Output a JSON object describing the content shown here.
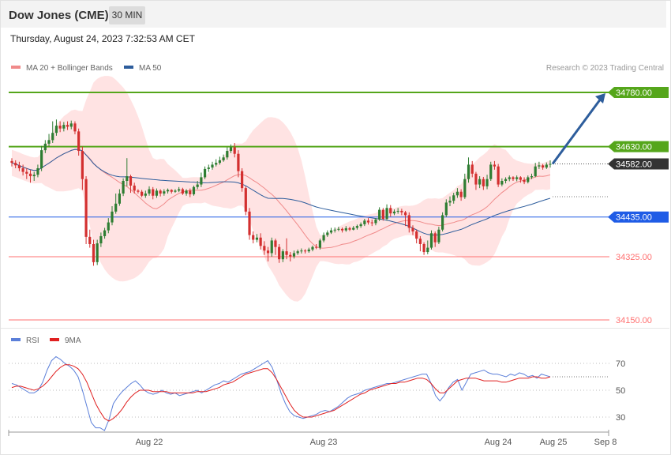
{
  "header": {
    "title": "Dow Jones (CME)",
    "interval": "30 MIN",
    "timestamp": "Thursday, August 24, 2023 7:32:53 AM CET",
    "copyright": "Research © 2023 Trading Central"
  },
  "legend_main": [
    {
      "label": "MA 20 + Bollinger Bands",
      "color": "#f08a8a"
    },
    {
      "label": "MA 50",
      "color": "#2d5d9c"
    }
  ],
  "legend_rsi": [
    {
      "label": "RSI",
      "color": "#5b7fd9"
    },
    {
      "label": "9MA",
      "color": "#e02020"
    }
  ],
  "chart_data": [
    {
      "type": "candlestick",
      "price_range": [
        34150,
        34830
      ],
      "levels": [
        {
          "value": 34780,
          "label": "34780.00",
          "color": "#55a61b",
          "style": "resistance"
        },
        {
          "value": 34630,
          "label": "34630.00",
          "color": "#55a61b",
          "style": "resistance"
        },
        {
          "value": 34582,
          "label": "34582.00",
          "color": "#333333",
          "style": "last"
        },
        {
          "value": 34435,
          "label": "34435.00",
          "color": "#1f5ce6",
          "style": "pivot"
        },
        {
          "value": 34325,
          "label": "34325.00",
          "color": "#ff7070",
          "style": "support"
        },
        {
          "value": 34150,
          "label": "34150.00",
          "color": "#ff7070",
          "style": "support"
        }
      ],
      "candles": [
        [
          34590,
          34585,
          34598,
          34575
        ],
        [
          34585,
          34578,
          34592,
          34570
        ],
        [
          34578,
          34570,
          34588,
          34562
        ],
        [
          34570,
          34560,
          34580,
          34550
        ],
        [
          34560,
          34555,
          34570,
          34540
        ],
        [
          34555,
          34548,
          34565,
          34530
        ],
        [
          34548,
          34552,
          34560,
          34535
        ],
        [
          34552,
          34570,
          34580,
          34545
        ],
        [
          34570,
          34620,
          34632,
          34562
        ],
        [
          34620,
          34638,
          34648,
          34612
        ],
        [
          34638,
          34648,
          34665,
          34630
        ],
        [
          34648,
          34668,
          34700,
          34640
        ],
        [
          34668,
          34688,
          34705,
          34660
        ],
        [
          34688,
          34680,
          34700,
          34670
        ],
        [
          34680,
          34690,
          34698,
          34672
        ],
        [
          34690,
          34685,
          34700,
          34676
        ],
        [
          34685,
          34694,
          34702,
          34678
        ],
        [
          34694,
          34672,
          34700,
          34664
        ],
        [
          34672,
          34618,
          34680,
          34605
        ],
        [
          34618,
          34540,
          34630,
          34510
        ],
        [
          34540,
          34380,
          34548,
          34360
        ],
        [
          34380,
          34360,
          34400,
          34350
        ],
        [
          34360,
          34310,
          34372,
          34300
        ],
        [
          34310,
          34362,
          34372,
          34302
        ],
        [
          34362,
          34382,
          34392,
          34352
        ],
        [
          34382,
          34398,
          34405,
          34375
        ],
        [
          34398,
          34420,
          34432,
          34390
        ],
        [
          34420,
          34450,
          34465,
          34412
        ],
        [
          34450,
          34472,
          34500,
          34444
        ],
        [
          34472,
          34500,
          34512,
          34466
        ],
        [
          34500,
          34535,
          34542,
          34493
        ],
        [
          34535,
          34548,
          34598,
          34520
        ],
        [
          34548,
          34522,
          34552,
          34502
        ],
        [
          34522,
          34508,
          34530,
          34500
        ],
        [
          34508,
          34505,
          34512,
          34500
        ],
        [
          34505,
          34494,
          34510,
          34490
        ],
        [
          34494,
          34500,
          34508,
          34488
        ],
        [
          34500,
          34512,
          34520,
          34494
        ],
        [
          34512,
          34494,
          34518,
          34484
        ],
        [
          34494,
          34508,
          34514,
          34488
        ],
        [
          34508,
          34500,
          34512,
          34492
        ],
        [
          34500,
          34506,
          34512,
          34494
        ],
        [
          34506,
          34510,
          34514,
          34500
        ],
        [
          34510,
          34505,
          34512,
          34500
        ],
        [
          34505,
          34508,
          34512,
          34502
        ],
        [
          34508,
          34512,
          34518,
          34504
        ],
        [
          34512,
          34500,
          34516,
          34496
        ],
        [
          34500,
          34508,
          34512,
          34494
        ],
        [
          34508,
          34498,
          34514,
          34490
        ],
        [
          34498,
          34518,
          34522,
          34494
        ],
        [
          34518,
          34525,
          34535,
          34512
        ],
        [
          34525,
          34545,
          34558,
          34518
        ],
        [
          34545,
          34568,
          34575,
          34540
        ],
        [
          34568,
          34572,
          34580,
          34560
        ],
        [
          34572,
          34580,
          34588,
          34566
        ],
        [
          34580,
          34585,
          34595,
          34575
        ],
        [
          34585,
          34592,
          34602,
          34580
        ],
        [
          34592,
          34600,
          34608,
          34588
        ],
        [
          34600,
          34618,
          34628,
          34594
        ],
        [
          34618,
          34628,
          34636,
          34612
        ],
        [
          34628,
          34610,
          34640,
          34600
        ],
        [
          34610,
          34562,
          34620,
          34545
        ],
        [
          34562,
          34515,
          34570,
          34505
        ],
        [
          34515,
          34450,
          34520,
          34440
        ],
        [
          34450,
          34385,
          34460,
          34372
        ],
        [
          34385,
          34372,
          34395,
          34362
        ],
        [
          34372,
          34378,
          34388,
          34365
        ],
        [
          34378,
          34355,
          34390,
          34345
        ],
        [
          34355,
          34342,
          34368,
          34330
        ],
        [
          34342,
          34335,
          34352,
          34312
        ],
        [
          34335,
          34370,
          34378,
          34325
        ],
        [
          34370,
          34352,
          34375,
          34330
        ],
        [
          34352,
          34318,
          34360,
          34308
        ],
        [
          34318,
          34340,
          34346,
          34310
        ],
        [
          34340,
          34330,
          34376,
          34318
        ],
        [
          34330,
          34326,
          34338,
          34312
        ],
        [
          34326,
          34335,
          34342,
          34320
        ],
        [
          34335,
          34340,
          34345,
          34330
        ],
        [
          34340,
          34342,
          34348,
          34334
        ],
        [
          34342,
          34340,
          34346,
          34334
        ],
        [
          34340,
          34345,
          34350,
          34336
        ],
        [
          34345,
          34352,
          34356,
          34340
        ],
        [
          34352,
          34350,
          34360,
          34346
        ],
        [
          34350,
          34370,
          34375,
          34345
        ],
        [
          34370,
          34385,
          34392,
          34365
        ],
        [
          34385,
          34392,
          34398,
          34380
        ],
        [
          34392,
          34398,
          34405,
          34388
        ],
        [
          34398,
          34400,
          34406,
          34392
        ],
        [
          34400,
          34402,
          34408,
          34396
        ],
        [
          34402,
          34398,
          34406,
          34392
        ],
        [
          34398,
          34404,
          34410,
          34394
        ],
        [
          34404,
          34400,
          34408,
          34396
        ],
        [
          34400,
          34405,
          34410,
          34398
        ],
        [
          34405,
          34410,
          34414,
          34400
        ],
        [
          34410,
          34415,
          34420,
          34405
        ],
        [
          34415,
          34425,
          34430,
          34410
        ],
        [
          34425,
          34420,
          34432,
          34414
        ],
        [
          34420,
          34418,
          34428,
          34410
        ],
        [
          34418,
          34428,
          34432,
          34412
        ],
        [
          34428,
          34455,
          34462,
          34424
        ],
        [
          34455,
          34430,
          34460,
          34425
        ],
        [
          34430,
          34460,
          34470,
          34425
        ],
        [
          34460,
          34445,
          34468,
          34436
        ],
        [
          34445,
          34450,
          34456,
          34440
        ],
        [
          34450,
          34452,
          34460,
          34444
        ],
        [
          34452,
          34448,
          34458,
          34440
        ],
        [
          34448,
          34440,
          34452,
          34410
        ],
        [
          34440,
          34405,
          34448,
          34392
        ],
        [
          34405,
          34395,
          34412,
          34385
        ],
        [
          34395,
          34375,
          34400,
          34362
        ],
        [
          34375,
          34360,
          34382,
          34340
        ],
        [
          34360,
          34338,
          34365,
          34330
        ],
        [
          34338,
          34350,
          34370,
          34332
        ],
        [
          34350,
          34390,
          34398,
          34345
        ],
        [
          34390,
          34365,
          34395,
          34352
        ],
        [
          34365,
          34400,
          34408,
          34360
        ],
        [
          34400,
          34440,
          34448,
          34395
        ],
        [
          34440,
          34475,
          34484,
          34435
        ],
        [
          34475,
          34480,
          34492,
          34465
        ],
        [
          34480,
          34495,
          34502,
          34472
        ],
        [
          34495,
          34505,
          34515,
          34488
        ],
        [
          34505,
          34490,
          34512,
          34480
        ],
        [
          34490,
          34540,
          34555,
          34485
        ],
        [
          34540,
          34580,
          34600,
          34530
        ],
        [
          34580,
          34555,
          34590,
          34545
        ],
        [
          34555,
          34525,
          34560,
          34510
        ],
        [
          34525,
          34540,
          34548,
          34515
        ],
        [
          34540,
          34520,
          34546,
          34510
        ],
        [
          34520,
          34540,
          34552,
          34512
        ],
        [
          34540,
          34580,
          34588,
          34535
        ],
        [
          34580,
          34575,
          34590,
          34566
        ],
        [
          34575,
          34525,
          34582,
          34518
        ],
        [
          34525,
          34535,
          34542,
          34520
        ],
        [
          34535,
          34540,
          34545,
          34528
        ],
        [
          34540,
          34545,
          34550,
          34534
        ],
        [
          34545,
          34540,
          34548,
          34535
        ],
        [
          34540,
          34545,
          34550,
          34534
        ],
        [
          34545,
          34538,
          34548,
          34530
        ],
        [
          34538,
          34532,
          34545,
          34526
        ],
        [
          34532,
          34545,
          34550,
          34528
        ],
        [
          34545,
          34548,
          34555,
          34540
        ],
        [
          34548,
          34575,
          34585,
          34545
        ],
        [
          34575,
          34578,
          34588,
          34568
        ],
        [
          34578,
          34572,
          34582,
          34566
        ],
        [
          34572,
          34580,
          34586,
          34568
        ],
        [
          34580,
          34582,
          34592,
          34572
        ]
      ],
      "series": [
        {
          "name": "MA 20 + Bollinger Bands"
        },
        {
          "name": "MA 50"
        }
      ]
    },
    {
      "type": "line",
      "y_ticks": [
        70,
        50,
        30
      ],
      "y_range": [
        20,
        80
      ],
      "series": [
        {
          "name": "RSI",
          "values": [
            55,
            54,
            52,
            50,
            48,
            48,
            50,
            56,
            65,
            72,
            75,
            73,
            70,
            68,
            65,
            60,
            50,
            38,
            26,
            22,
            22,
            20,
            28,
            40,
            45,
            49,
            52,
            55,
            57,
            54,
            50,
            48,
            47,
            48,
            50,
            48,
            47,
            48,
            46,
            47,
            48,
            49,
            50,
            48,
            50,
            52,
            54,
            55,
            57,
            56,
            58,
            60,
            62,
            63,
            64,
            66,
            68,
            70,
            72,
            67,
            58,
            48,
            40,
            34,
            31,
            30,
            29,
            30,
            31,
            32,
            34,
            35,
            34,
            36,
            38,
            41,
            44,
            46,
            47,
            48,
            50,
            51,
            52,
            53,
            54,
            55,
            55,
            56,
            57,
            58,
            59,
            60,
            61,
            62,
            62,
            55,
            46,
            42,
            46,
            52,
            56,
            58,
            50,
            56,
            62,
            63,
            64,
            65,
            63,
            62,
            62,
            61,
            60,
            62,
            61,
            63,
            62,
            60,
            61,
            59,
            62,
            61,
            60
          ]
        },
        {
          "name": "9MA",
          "values": [
            52,
            53,
            53,
            52,
            51,
            50,
            51,
            53,
            56,
            60,
            64,
            67,
            69,
            69,
            68,
            66,
            62,
            56,
            48,
            40,
            34,
            29,
            27,
            29,
            32,
            36,
            41,
            45,
            48,
            50,
            50,
            50,
            49,
            49,
            49,
            49,
            48,
            48,
            48,
            48,
            48,
            48,
            49,
            49,
            49,
            50,
            51,
            52,
            54,
            55,
            56,
            58,
            60,
            62,
            63,
            64,
            65,
            66,
            66,
            63,
            58,
            52,
            46,
            40,
            35,
            32,
            30,
            30,
            30,
            31,
            32,
            33,
            34,
            35,
            37,
            39,
            41,
            43,
            45,
            47,
            48,
            50,
            51,
            52,
            53,
            54,
            55,
            55,
            56,
            56,
            57,
            58,
            59,
            59,
            58,
            55,
            51,
            48,
            48,
            51,
            54,
            57,
            58,
            59,
            59,
            59,
            58,
            57,
            57,
            57,
            57,
            56,
            56,
            57,
            58,
            59,
            59,
            59,
            60,
            60,
            59,
            59,
            60
          ]
        }
      ]
    }
  ],
  "x_axis": {
    "labels": [
      "Aug 22",
      "Aug 23",
      "Aug 24",
      "Aug 25",
      "Sep 8"
    ]
  }
}
